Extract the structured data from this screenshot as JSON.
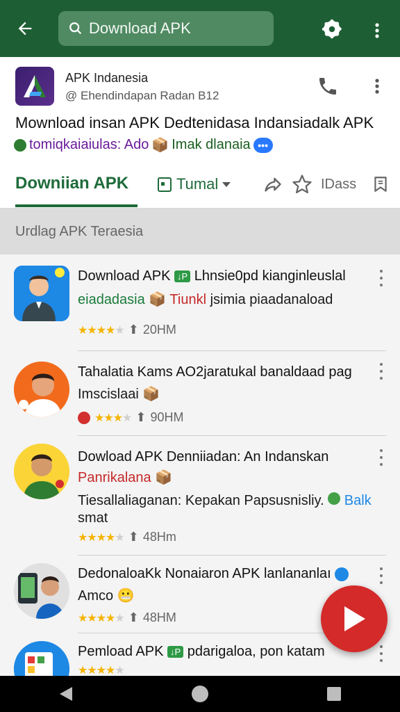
{
  "appbar": {
    "search_text": "Download APK",
    "icons": [
      "back-arrow-icon",
      "search-icon",
      "settings-gear-icon",
      "more-vert-icon"
    ],
    "background": "#1e5e34"
  },
  "header": {
    "publisher_name": "APK Indanesia",
    "publisher_handle": "@ Ehendindapan Radan B12",
    "title": "Mownload insan APK Dedtenidasa Indansiadalk APK",
    "subtitle_a": "tomiqkaiaiulas: Ado",
    "subtitle_b": "Imak dlanaia",
    "tabs": {
      "main": "Downiian APK",
      "secondary": "Tumal",
      "extra": "IDass"
    }
  },
  "section": {
    "title": "Urdlag APK Teraesia"
  },
  "items": [
    {
      "title": "Download APK",
      "badge": "↓P",
      "title_rest": "Lhnsie0pd kianginleuslal",
      "sub_a": "eiadadasia",
      "sub_b": "Tiunkl",
      "sub_c": "jsimia piaadanaload",
      "rating": 4,
      "size": "20HM"
    },
    {
      "title": "Tahalatia Kams AO2jaratukal banaldaad pag",
      "sub_a": "Imscislaai",
      "rating": 3,
      "size": "90HM"
    },
    {
      "title": "Dowload APK Denniiadan: An Indanskan",
      "sub_a": "Panrikalana",
      "sub_b": "Tiesallaliaganan: Kepakan Papsusnisliy.",
      "sub_c": "Balk",
      "sub_d": "smat",
      "rating": 4,
      "size": "48Hm"
    },
    {
      "title": "DedonaloaKk Nonaiaron APK lanlananlaı",
      "sub_a": "Amco",
      "rating": 4,
      "size": "48HM"
    },
    {
      "title": "Pemload APK",
      "badge": "↓P",
      "title_rest": "pdarigaloa, pon katam",
      "rating": 4,
      "size": ""
    }
  ],
  "colors": {
    "accent": "#1e6b3a",
    "fab": "#d42a2a",
    "star": "#f5b400"
  }
}
